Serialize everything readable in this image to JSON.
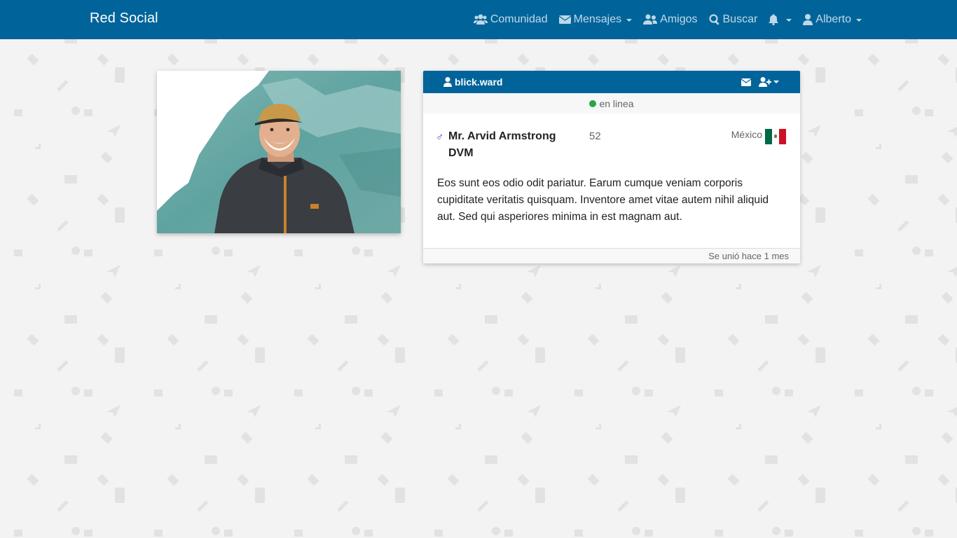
{
  "navbar": {
    "brand": "Red Social",
    "items": [
      {
        "label": "Comunidad",
        "icon": "users-icon"
      },
      {
        "label": "Mensajes",
        "icon": "envelope-icon"
      },
      {
        "label": "Amigos",
        "icon": "user-friends-icon"
      },
      {
        "label": "Buscar",
        "icon": "search-icon"
      },
      {
        "label": "",
        "icon": "bell-icon"
      },
      {
        "label": "Alberto",
        "icon": "user-icon"
      }
    ]
  },
  "profile": {
    "username": "blick.ward",
    "status": "en linea",
    "gender_symbol": "♂",
    "name": "Mr. Arvid Armstrong DVM",
    "age": "52",
    "country": "México",
    "description": "Eos sunt eos odio odit pariatur. Earum cumque veniam corporis cupiditate veritatis quisquam. Inventore amet vitae autem nihil aliquid aut. Sed qui asperiores minima in est magnam aut.",
    "joined": "Se unió hace 1 mes"
  },
  "colors": {
    "navbar": "#00649b",
    "status_online": "#28a745",
    "gender": "#2a3ec4",
    "background": "#f3f3f3"
  }
}
